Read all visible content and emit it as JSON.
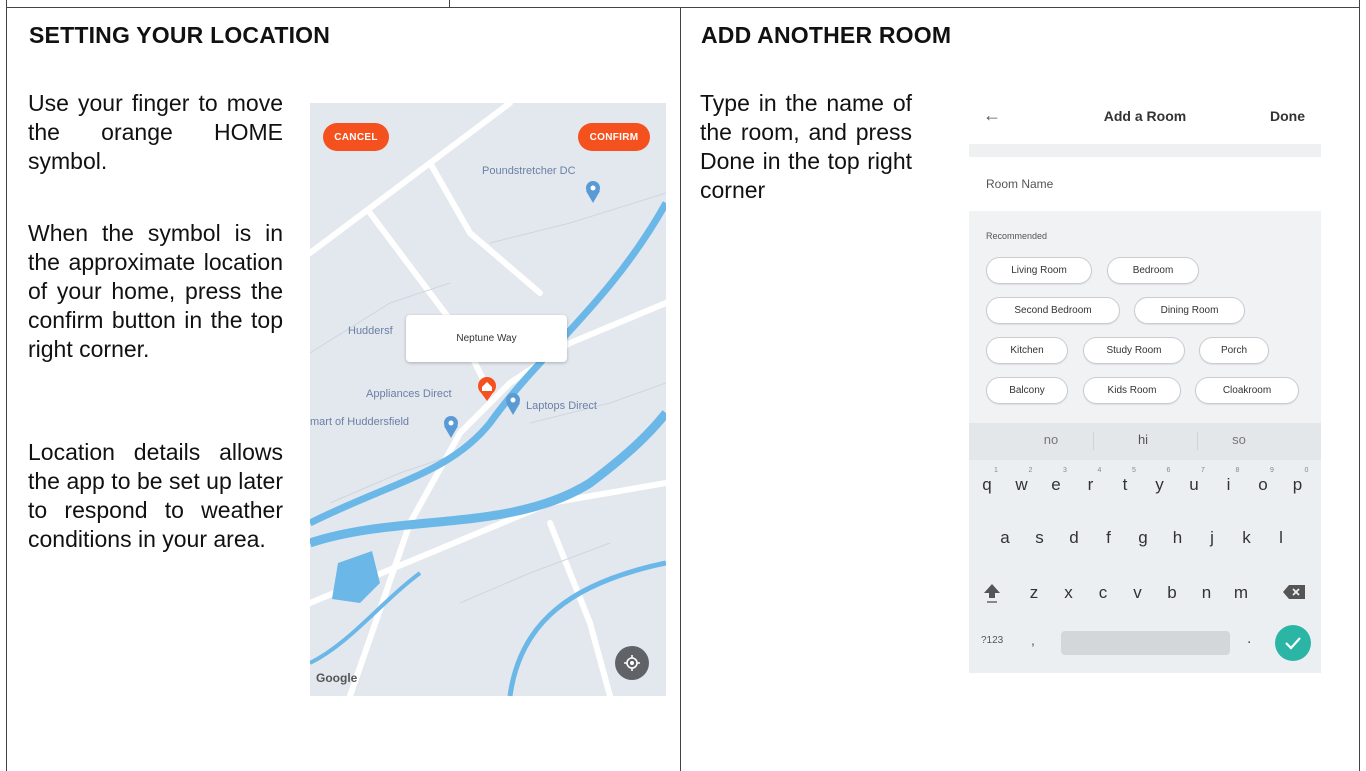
{
  "left_panel": {
    "title": "SETTING YOUR LOCATION",
    "paragraphs": [
      "Use your finger to move the orange HOME symbol.",
      "When the symbol is in the approximate location of your home, press the confirm button in the top right corner.",
      "Location details allows the app to be set up later to respond to weather conditions in your area."
    ]
  },
  "map_screen": {
    "cancel_label": "CANCEL",
    "confirm_label": "CONFIRM",
    "popup_text": "Neptune Way",
    "places": {
      "poundstretcher": "Poundstretcher DC",
      "huddersfield": "Huddersf",
      "appliances": "Appliances Direct",
      "laptops": "Laptops Direct",
      "mart": "mart of Huddersfield"
    },
    "google": "Google",
    "colors": {
      "accent": "#f4511e",
      "water": "#6bb8e8",
      "pin": "#5a9bd5"
    }
  },
  "right_panel": {
    "title": "ADD ANOTHER ROOM",
    "paragraph": "Type in the name of the room, and press Done in the top right corner"
  },
  "room_screen": {
    "back_icon": "arrow-left-icon",
    "title": "Add a Room",
    "done_label": "Done",
    "room_name_label": "Room Name",
    "recommended_label": "Recommended",
    "chips": [
      "Living Room",
      "Bedroom",
      "Second Bedroom",
      "Dining Room",
      "Kitchen",
      "Study Room",
      "Porch",
      "Balcony",
      "Kids Room",
      "Cloakroom"
    ],
    "suggestions": [
      "no",
      "hi",
      "so"
    ],
    "keyboard": {
      "row1": [
        "q",
        "w",
        "e",
        "r",
        "t",
        "y",
        "u",
        "i",
        "o",
        "p"
      ],
      "row1_numbers": [
        "1",
        "2",
        "3",
        "4",
        "5",
        "6",
        "7",
        "8",
        "9",
        "0"
      ],
      "row2": [
        "a",
        "s",
        "d",
        "f",
        "g",
        "h",
        "j",
        "k",
        "l"
      ],
      "row3": [
        "z",
        "x",
        "c",
        "v",
        "b",
        "n",
        "m"
      ],
      "symbols_key": "?123",
      "comma_key": ",",
      "period_key": "."
    },
    "colors": {
      "enter": "#2bb5a5"
    }
  }
}
